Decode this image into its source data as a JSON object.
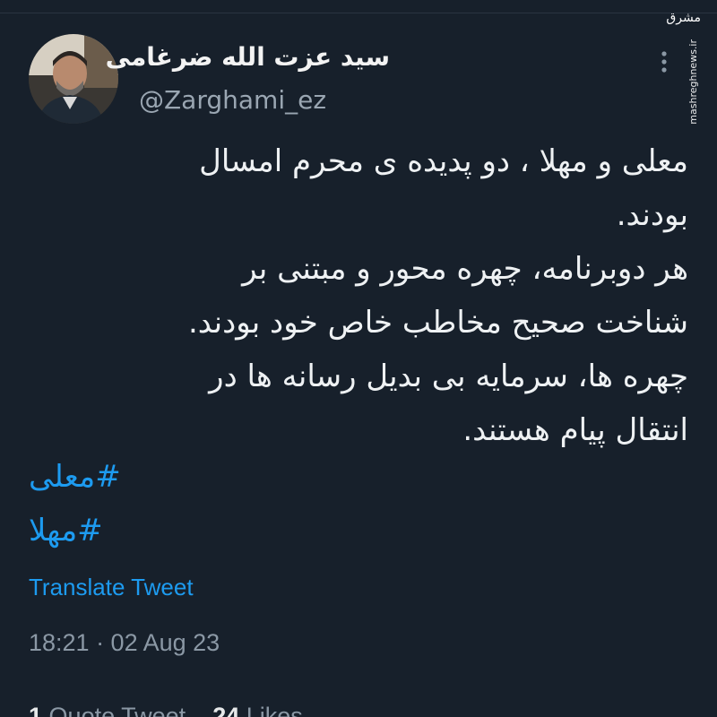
{
  "author": {
    "name": "سید عزت الله ضرغامی",
    "handle": "@Zarghami_ez",
    "avatar": "avatar-photo"
  },
  "tweet": {
    "lines": [
      "معلی و مهلا ، دو پدیده ی محرم امسال",
      "بودند.",
      "هر دوبرنامه، چهره محور و مبتنی بر",
      "شناخت صحیح مخاطب خاص خود بودند.",
      "چهره ها، سرمایه بی بدیل رسانه ها در",
      "انتقال پیام هستند."
    ],
    "hashtags": [
      "#معلی",
      "#مهلا"
    ],
    "translate_label": "Translate Tweet",
    "timestamp": "18:21 · 02 Aug 23"
  },
  "engagement": {
    "quote_count": "1",
    "quote_label": "Quote Tweet",
    "likes_count": "24",
    "likes_label": "Likes"
  },
  "watermark": {
    "logo": "مشرق",
    "site": "mashreghnews.ir"
  },
  "colors": {
    "background": "#17202b",
    "link": "#1d9bf0",
    "secondary_text": "#8b98a5"
  },
  "icons": {
    "more": "more-vertical-icon"
  }
}
